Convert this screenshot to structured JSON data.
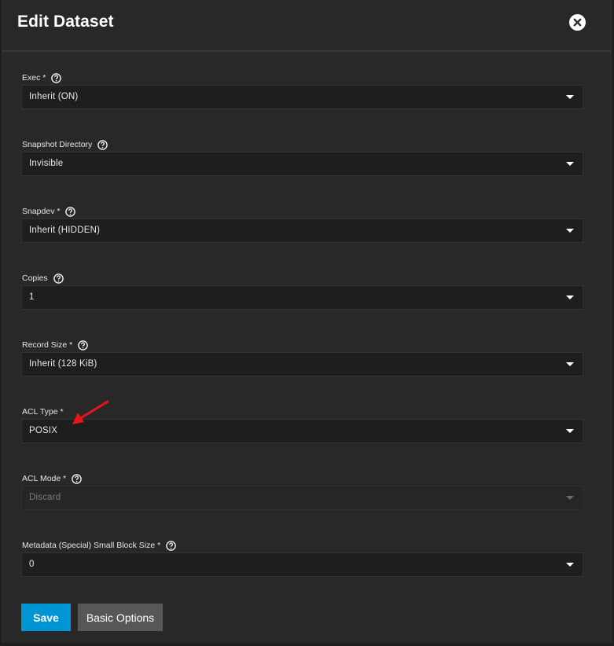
{
  "dialog": {
    "title": "Edit Dataset",
    "close_icon": "close-circle-icon"
  },
  "fields": [
    {
      "label": "Exec *",
      "value": "Inherit (ON)",
      "has_help": true,
      "disabled": false
    },
    {
      "label": "Snapshot Directory",
      "value": "Invisible",
      "has_help": true,
      "disabled": false
    },
    {
      "label": "Snapdev *",
      "value": "Inherit (HIDDEN)",
      "has_help": true,
      "disabled": false
    },
    {
      "label": "Copies",
      "value": "1",
      "has_help": true,
      "disabled": false
    },
    {
      "label": "Record Size *",
      "value": "Inherit (128 KiB)",
      "has_help": true,
      "disabled": false
    },
    {
      "label": "ACL Type *",
      "value": "POSIX",
      "has_help": false,
      "disabled": false
    },
    {
      "label": "ACL Mode *",
      "value": "Discard",
      "has_help": true,
      "disabled": true
    },
    {
      "label": "Metadata (Special) Small Block Size *",
      "value": "0",
      "has_help": true,
      "disabled": false
    }
  ],
  "actions": {
    "save_label": "Save",
    "basic_options_label": "Basic Options"
  },
  "colors": {
    "primary": "#0095d5",
    "secondary": "#575757",
    "annotation_arrow": "#e8141b"
  }
}
